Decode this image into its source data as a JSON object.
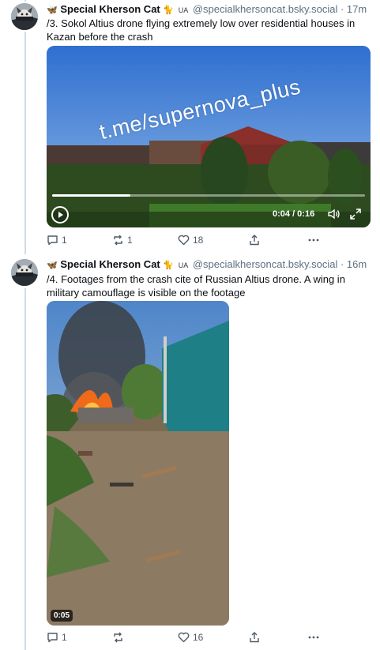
{
  "posts": [
    {
      "author": "Special Kherson Cat",
      "flag": "UA",
      "handle": "@specialkhersoncat.bsky.social",
      "time": "· 17m",
      "text": "/3. Sokol Altius drone flying extremely low over residential houses in Kazan before the crash",
      "video": {
        "watermark": "t.me/supernova_plus",
        "time": "0:04 / 0:16",
        "progress": 0.25
      },
      "stats": {
        "replies": "1",
        "reposts": "1",
        "likes": "18"
      }
    },
    {
      "author": "Special Kherson Cat",
      "flag": "UA",
      "handle": "@specialkhersoncat.bsky.social",
      "time": "· 16m",
      "text": "/4. Footages from the crash cite of Russian Altius drone. A wing in military camouflage is visible on the footage",
      "video": {
        "duration": "0:05"
      },
      "stats": {
        "replies": "1",
        "reposts": "",
        "likes": "16"
      }
    }
  ],
  "icons": [
    "butterfly-icon",
    "cat-icon",
    "reply-icon",
    "repost-icon",
    "like-icon",
    "share-icon",
    "more-icon",
    "play-icon",
    "volume-icon",
    "fullscreen-icon"
  ],
  "colors": {
    "handle": "#5b7083",
    "thread_line": "#d4dbe2",
    "text": "#0b0f14"
  }
}
